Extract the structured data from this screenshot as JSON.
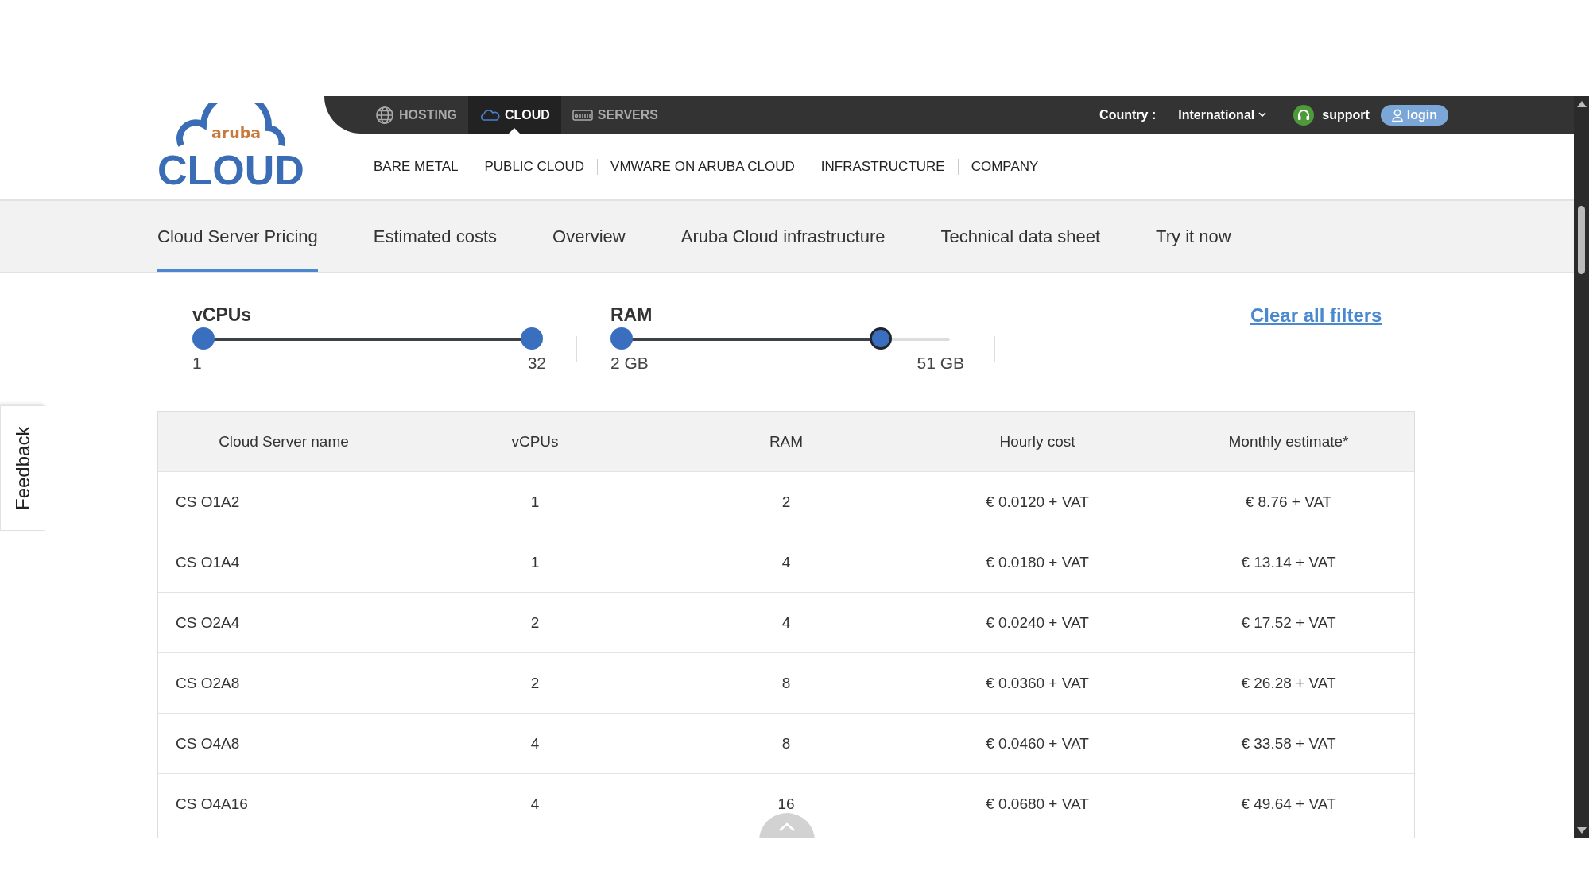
{
  "logo": {
    "script": "aruba",
    "word": "CLOUD"
  },
  "top_bar": {
    "sections": [
      {
        "label": "HOSTING",
        "selected": false
      },
      {
        "label": "CLOUD",
        "selected": true
      },
      {
        "label": "SERVERS",
        "selected": false
      }
    ],
    "country_label": "Country :",
    "country": "International",
    "support": "support",
    "login": "login"
  },
  "main_nav": [
    "BARE METAL",
    "PUBLIC CLOUD",
    "VMWARE ON ARUBA CLOUD",
    "INFRASTRUCTURE",
    "COMPANY"
  ],
  "tabs": [
    {
      "label": "Cloud Server Pricing",
      "selected": true
    },
    {
      "label": "Estimated costs",
      "selected": false
    },
    {
      "label": "Overview",
      "selected": false
    },
    {
      "label": "Aruba Cloud infrastructure",
      "selected": false
    },
    {
      "label": "Technical data sheet",
      "selected": false
    },
    {
      "label": "Try it now",
      "selected": false
    }
  ],
  "filters": [
    {
      "label": "vCPUs",
      "min_label": "1",
      "max_label": "32",
      "thumbs": [
        {
          "level": 0,
          "focused": false
        },
        {
          "level": 1,
          "focused": false
        }
      ]
    },
    {
      "label": "RAM",
      "min_label": "2 GB",
      "max_label": "51 GB",
      "thumbs": [
        {
          "level": 0,
          "focused": false
        },
        {
          "level": 0.79,
          "focused": true
        }
      ]
    }
  ],
  "clear_filters": "Clear all filters",
  "table": {
    "columns": [
      "Cloud Server name",
      "vCPUs",
      "RAM",
      "Hourly cost",
      "Monthly estimate*"
    ],
    "rows": [
      [
        "CS O1A2",
        "1",
        "2",
        "€ 0.0120 + VAT",
        "€ 8.76 + VAT"
      ],
      [
        "CS O1A4",
        "1",
        "4",
        "€ 0.0180 + VAT",
        "€ 13.14 + VAT"
      ],
      [
        "CS O2A4",
        "2",
        "4",
        "€ 0.0240 + VAT",
        "€ 17.52 + VAT"
      ],
      [
        "CS O2A8",
        "2",
        "8",
        "€ 0.0360 + VAT",
        "€ 26.28 + VAT"
      ],
      [
        "CS O4A8",
        "4",
        "8",
        "€ 0.0460 + VAT",
        "€ 33.58 + VAT"
      ],
      [
        "CS O4A16",
        "4",
        "16",
        "€ 0.0680 + VAT",
        "€ 49.64 + VAT"
      ]
    ]
  },
  "feedback": "Feedback"
}
